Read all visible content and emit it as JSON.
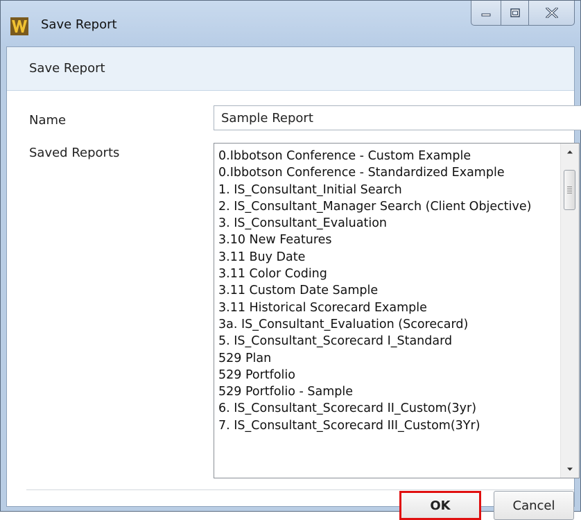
{
  "window": {
    "title": "Save Report"
  },
  "dialog": {
    "header_title": "Save Report",
    "name_label": "Name",
    "name_value": "Sample Report",
    "saved_reports_label": "Saved Reports",
    "saved_reports": [
      "0.Ibbotson Conference - Custom Example",
      "0.Ibbotson Conference - Standardized Example",
      "1. IS_Consultant_Initial Search",
      "2. IS_Consultant_Manager Search (Client Objective)",
      "3. IS_Consultant_Evaluation",
      "3.10 New Features",
      "3.11 Buy Date",
      "3.11 Color Coding",
      "3.11 Custom Date Sample",
      "3.11 Historical Scorecard Example",
      "3a. IS_Consultant_Evaluation (Scorecard)",
      "5. IS_Consultant_Scorecard I_Standard",
      "529 Plan",
      "529 Portfolio",
      "529 Portfolio - Sample",
      "6. IS_Consultant_Scorecard II_Custom(3yr)",
      "7. IS_Consultant_Scorecard III_Custom(3Yr)"
    ],
    "ok_label": "OK",
    "cancel_label": "Cancel"
  },
  "icons": {
    "app": "app-logo-icon",
    "minimize": "minimize-icon",
    "maximize": "maximize-icon",
    "close": "close-icon",
    "scroll_up": "scroll-up-arrow-icon",
    "scroll_down": "scroll-down-arrow-icon"
  },
  "colors": {
    "titlebar": "#b8cde6",
    "header_background": "#e9f1f9",
    "ok_highlight": "#e01010"
  }
}
